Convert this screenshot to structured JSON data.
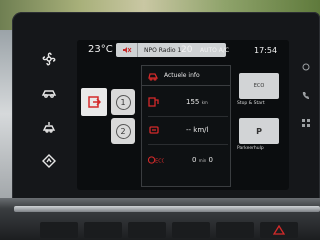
{
  "statusbar": {
    "temp_left": "23°C",
    "radio_station": "NPO Radio 1",
    "temp_right": "20",
    "ac_mode": "AUTO A/C",
    "time": "17:54"
  },
  "panel": {
    "title": "Actuele info",
    "range_value": "155",
    "range_unit": "km",
    "fuel_value": "-- km/l",
    "eco_value": "0",
    "eco_unit": "min",
    "eco_sec": "0"
  },
  "cards": {
    "stop_start": {
      "top": "ECO",
      "label": "Stop & Start"
    },
    "park_assist": {
      "top": "P",
      "label": "Parkeerhulp"
    }
  },
  "nav": {
    "page1": "1",
    "page2": "2"
  },
  "icons": {
    "side_tab": "exit-icon",
    "panel_head": "car-tire-icon",
    "range": "fuel-pump-icon",
    "fuel": "car-fuel-icon",
    "eco": "eco-icon"
  },
  "colors": {
    "accent_red": "#d42a2a"
  }
}
